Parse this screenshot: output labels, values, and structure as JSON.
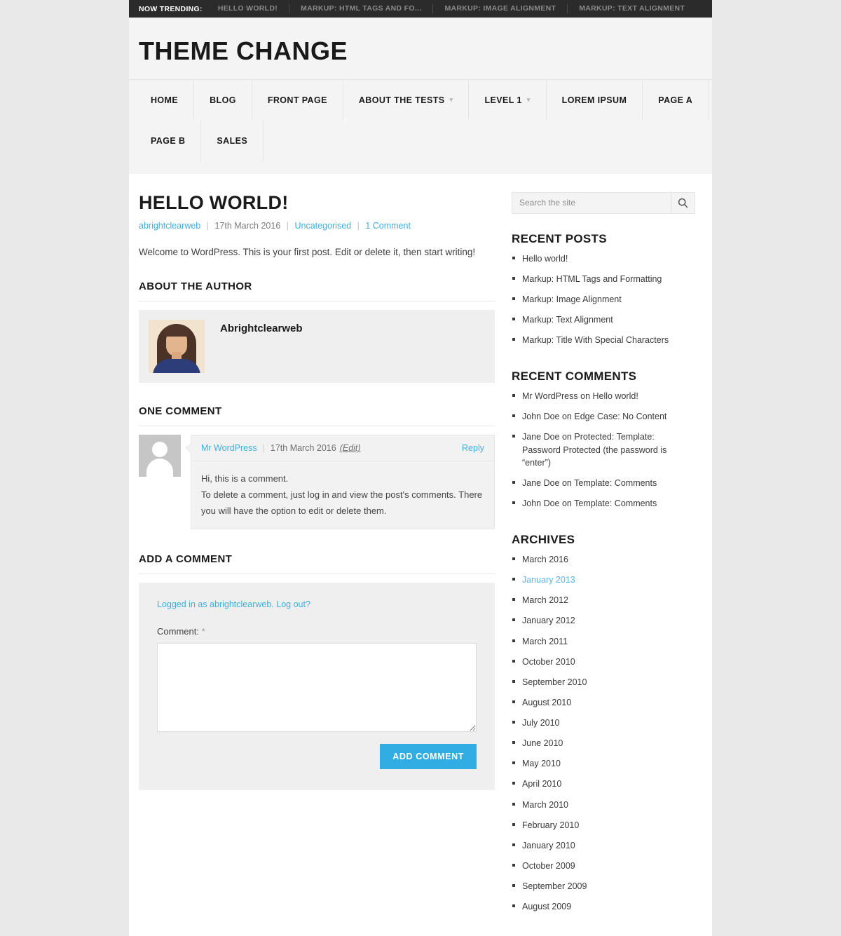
{
  "trending": {
    "label": "Now Trending:",
    "items": [
      "Hello world!",
      "Markup: HTML Tags and Fo...",
      "Markup: Image Alignment",
      "Markup: Text Alignment"
    ]
  },
  "header": {
    "site_title": "Theme Change"
  },
  "nav": {
    "row1": [
      {
        "label": "Home",
        "caret": ""
      },
      {
        "label": "Blog",
        "caret": ""
      },
      {
        "label": "Front Page",
        "caret": ""
      },
      {
        "label": "About The Tests",
        "caret": "▾"
      },
      {
        "label": "Level 1",
        "caret": "▾"
      },
      {
        "label": "Lorem Ipsum",
        "caret": ""
      },
      {
        "label": "Page A",
        "caret": ""
      }
    ],
    "row2": [
      {
        "label": "Page B",
        "caret": ""
      },
      {
        "label": "Sales",
        "caret": ""
      }
    ]
  },
  "post": {
    "title": "Hello world!",
    "author": "abrightclearweb",
    "date": "17th March 2016",
    "category": "Uncategorised",
    "comment_count": "1 Comment",
    "separator": "|",
    "body": "Welcome to WordPress. This is your first post. Edit or delete it, then start writing!"
  },
  "author_section": {
    "heading": "About the Author",
    "name": "Abrightclearweb"
  },
  "comments_section": {
    "heading": "One Comment",
    "items": [
      {
        "author": "Mr WordPress",
        "date": "17th March 2016",
        "edit": "(Edit)",
        "reply": "Reply",
        "text": "Hi, this is a comment.\nTo delete a comment, just log in and view the post's comments. There you will have the option to edit or delete them."
      }
    ]
  },
  "comment_form": {
    "heading": "Add a Comment",
    "logged_in_text": "Logged in as abrightclearweb.",
    "logout_label": "Log out?",
    "comment_label": "Comment:",
    "required_mark": "*",
    "textarea_value": "",
    "submit_label": "Add Comment",
    "accent_color": "#32ade4"
  },
  "sidebar": {
    "search": {
      "placeholder": "Search the site",
      "value": "",
      "icon": "search-icon"
    },
    "widgets": [
      {
        "title": "Recent Posts",
        "items": [
          {
            "label": "Hello world!",
            "active": false
          },
          {
            "label": "Markup: HTML Tags and Formatting",
            "active": false
          },
          {
            "label": "Markup: Image Alignment",
            "active": false
          },
          {
            "label": "Markup: Text Alignment",
            "active": false
          },
          {
            "label": "Markup: Title With Special Characters",
            "active": false
          }
        ]
      },
      {
        "title": "Recent Comments",
        "items": [
          {
            "label": "Mr WordPress on Hello world!",
            "active": false
          },
          {
            "label": "John Doe on Edge Case: No Content",
            "active": false
          },
          {
            "label": "Jane Doe on Protected: Template: Password Protected (the password is “enter”)",
            "active": false
          },
          {
            "label": "Jane Doe on Template: Comments",
            "active": false
          },
          {
            "label": "John Doe on Template: Comments",
            "active": false
          }
        ]
      },
      {
        "title": "Archives",
        "items": [
          {
            "label": "March 2016",
            "active": false
          },
          {
            "label": "January 2013",
            "active": true
          },
          {
            "label": "March 2012",
            "active": false
          },
          {
            "label": "January 2012",
            "active": false
          },
          {
            "label": "March 2011",
            "active": false
          },
          {
            "label": "October 2010",
            "active": false
          },
          {
            "label": "September 2010",
            "active": false
          },
          {
            "label": "August 2010",
            "active": false
          },
          {
            "label": "July 2010",
            "active": false
          },
          {
            "label": "June 2010",
            "active": false
          },
          {
            "label": "May 2010",
            "active": false
          },
          {
            "label": "April 2010",
            "active": false
          },
          {
            "label": "March 2010",
            "active": false
          },
          {
            "label": "February 2010",
            "active": false
          },
          {
            "label": "January 2010",
            "active": false
          },
          {
            "label": "October 2009",
            "active": false
          },
          {
            "label": "September 2009",
            "active": false
          },
          {
            "label": "August 2009",
            "active": false
          }
        ]
      }
    ]
  }
}
